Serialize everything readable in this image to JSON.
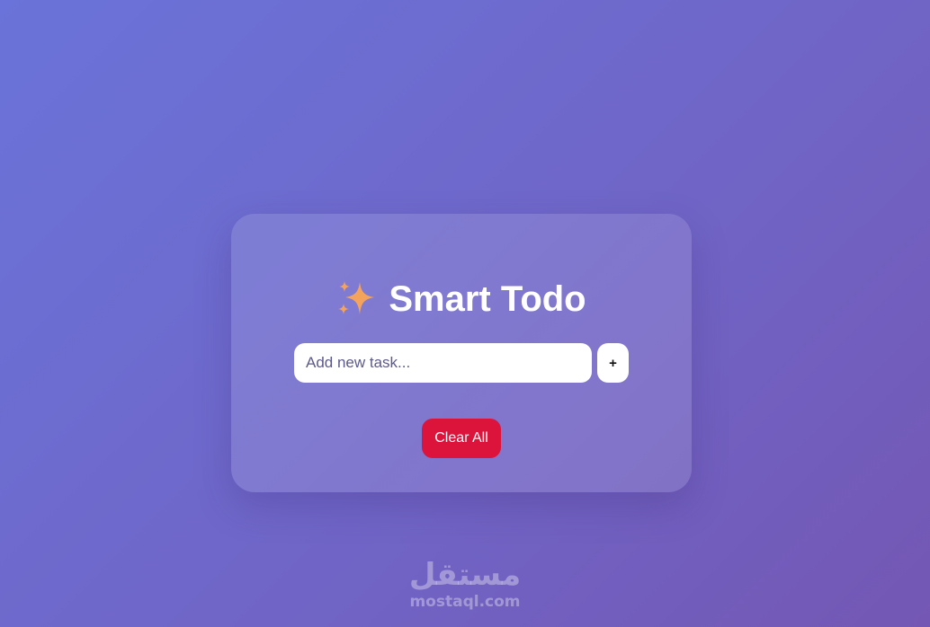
{
  "app": {
    "title": "Smart Todo",
    "title_icon": "sparkles-icon"
  },
  "input": {
    "placeholder": "Add new task...",
    "value": ""
  },
  "buttons": {
    "add_label": "+",
    "clear_label": "Clear All"
  },
  "colors": {
    "background_start": "#6a73d9",
    "background_end": "#7457b4",
    "clear_button": "#dc143c",
    "sparkle": "#f4a35c"
  },
  "watermark": {
    "logo_text": "مستقل",
    "url": "mostaql.com"
  }
}
